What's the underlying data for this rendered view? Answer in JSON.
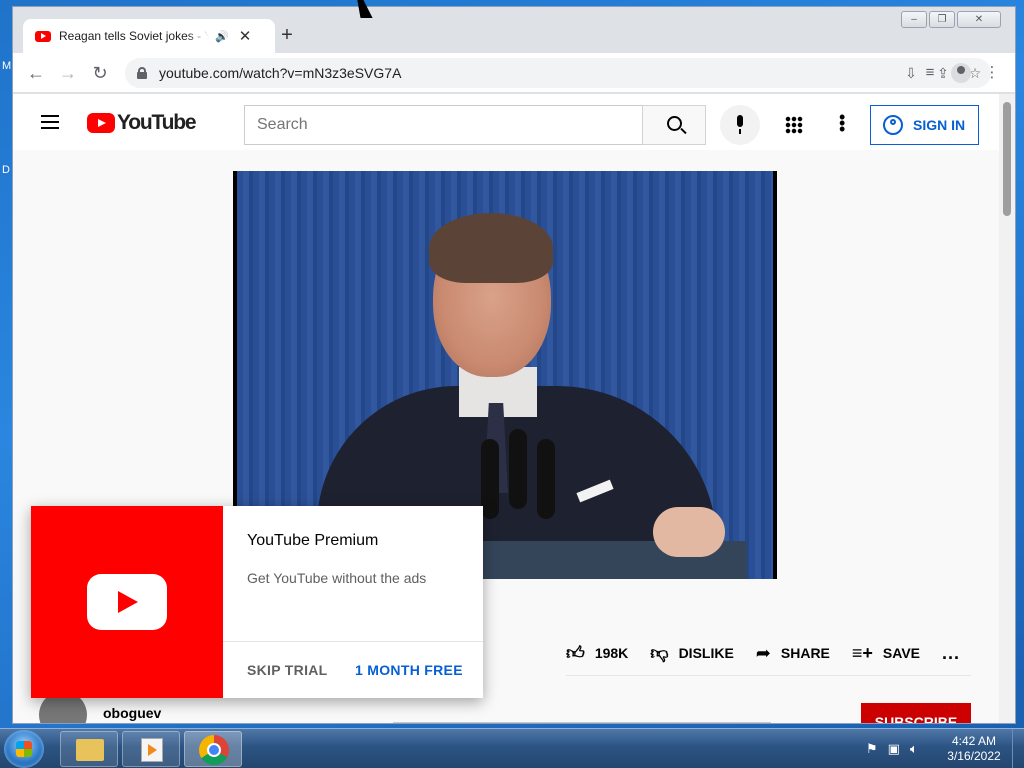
{
  "desktop": {
    "glyph_top": "M",
    "glyph_mid": "D"
  },
  "browser": {
    "tab": {
      "title": "Reagan tells Soviet jokes - YouTube",
      "audio_icon": "speaker-icon",
      "close_label": "✕"
    },
    "newtab_label": "+",
    "window_controls": [
      "minimize",
      "restore",
      "close"
    ],
    "url": "youtube.com/watch?v=mN3z3eSVG7A"
  },
  "youtube": {
    "logo_text": "YouTube",
    "search_placeholder": "Search",
    "signin_label": "SIGN IN",
    "actions": {
      "like_count": "198K",
      "dislike_label": "DISLIKE",
      "share_label": "SHARE",
      "save_label": "SAVE",
      "more_label": "..."
    },
    "channel": {
      "name": "oboguev"
    },
    "subscribe_label": "SUBSCRIBE"
  },
  "promo": {
    "title": "YouTube Premium",
    "description": "Get YouTube without the ads",
    "skip_label": "SKIP TRIAL",
    "accept_label": "1 MONTH FREE",
    "brand_color": "#ff0000"
  },
  "taskbar": {
    "time": "4:42 AM",
    "date": "3/16/2022"
  },
  "colors": {
    "accent": "#065fd4",
    "youtube_red": "#ff0000"
  }
}
